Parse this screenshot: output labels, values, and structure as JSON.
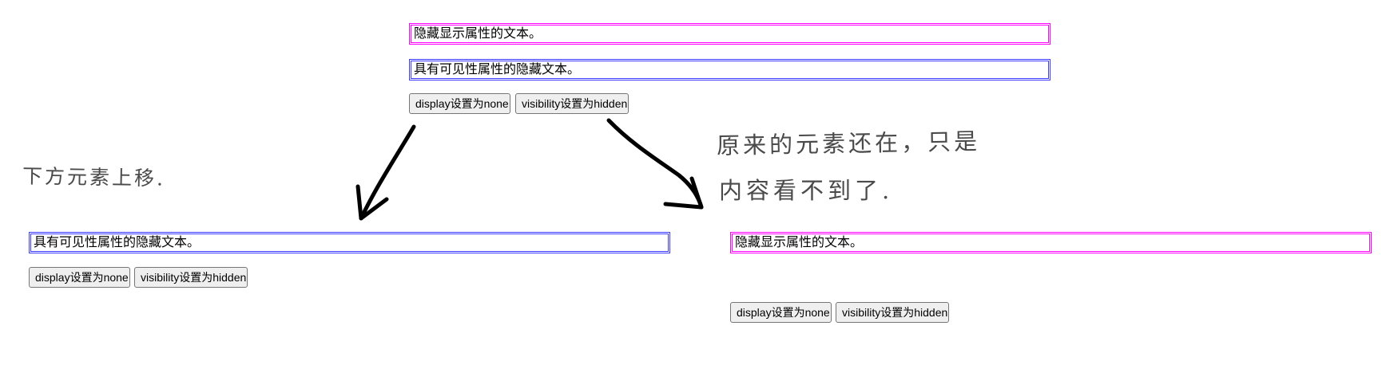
{
  "top": {
    "display_box_text": "隐藏显示属性的文本。",
    "visibility_box_text": "具有可见性属性的隐藏文本。",
    "display_button_label": "display设置为none",
    "visibility_button_label": "visibility设置为hidden"
  },
  "after_display_none": {
    "visibility_box_text": "具有可见性属性的隐藏文本。",
    "display_button_label": "display设置为none",
    "visibility_button_label": "visibility设置为hidden"
  },
  "after_visibility_hidden": {
    "display_box_text": "隐藏显示属性的文本。",
    "display_button_label": "display设置为none",
    "visibility_button_label": "visibility设置为hidden"
  },
  "annotations": {
    "left_note": "下方元素上移.",
    "right_note_line1": "原来的元素还在，只是",
    "right_note_line2": "内容看不到了."
  },
  "colors": {
    "display_box_border": "#ff00ff",
    "visibility_box_border": "#3a3aff",
    "annotation_ink": "#4a4a4a",
    "arrow_ink": "#000000"
  }
}
